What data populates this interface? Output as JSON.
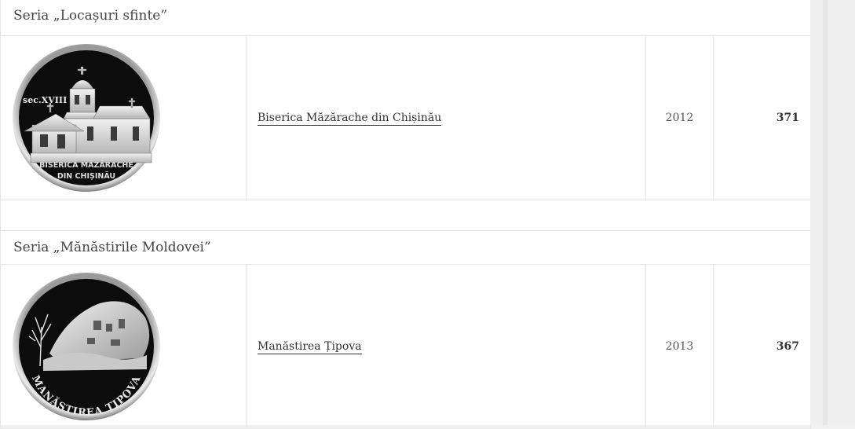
{
  "series": [
    {
      "title": "Seria „Locașuri sfinte”",
      "coins": [
        {
          "name": "Biserica Măzărache din Chișinău",
          "year": "2012",
          "number": "371",
          "coin_text_top": "sec.XVIII",
          "coin_text_line1": "BISERICA MĂZĂRACHE",
          "coin_text_line2": "DIN CHIȘINĂU"
        }
      ]
    },
    {
      "title": "Seria „Mănăstirile Moldovei”",
      "coins": [
        {
          "name": "Manăstirea Țipova",
          "year": "2013",
          "number": "367",
          "coin_text_line1": "MANĂSTIREA ȚIPOVA"
        }
      ]
    }
  ]
}
